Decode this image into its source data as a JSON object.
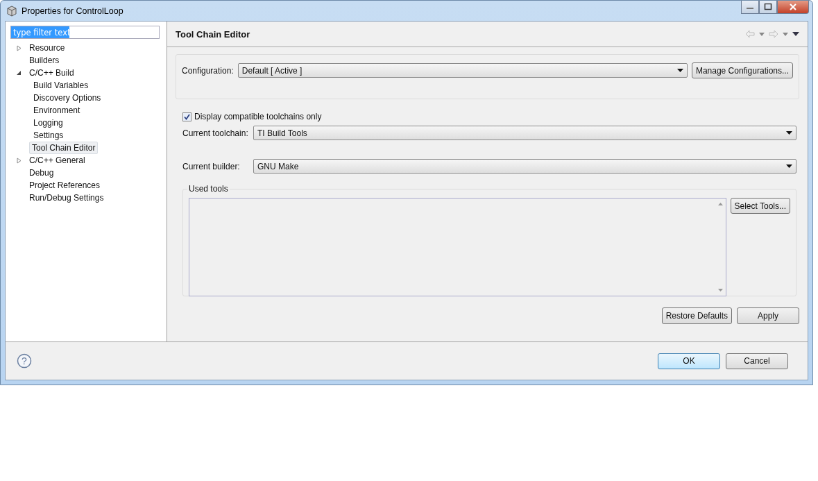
{
  "window": {
    "title": "Properties for ControlLoop"
  },
  "filter": {
    "value": "type filter text"
  },
  "tree": [
    {
      "label": "Resource",
      "kind": "group",
      "expanded": false,
      "selected": false
    },
    {
      "label": "Builders",
      "kind": "page",
      "selected": false
    },
    {
      "label": "C/C++ Build",
      "kind": "group",
      "expanded": true,
      "selected": false,
      "children": [
        {
          "label": "Build Variables",
          "selected": false
        },
        {
          "label": "Discovery Options",
          "selected": false
        },
        {
          "label": "Environment",
          "selected": false
        },
        {
          "label": "Logging",
          "selected": false
        },
        {
          "label": "Settings",
          "selected": false
        },
        {
          "label": "Tool Chain Editor",
          "selected": true
        }
      ]
    },
    {
      "label": "C/C++ General",
      "kind": "group",
      "expanded": false,
      "selected": false
    },
    {
      "label": "Debug",
      "kind": "page",
      "selected": false
    },
    {
      "label": "Project References",
      "kind": "page",
      "selected": false
    },
    {
      "label": "Run/Debug Settings",
      "kind": "page",
      "selected": false
    }
  ],
  "page": {
    "title": "Tool Chain Editor",
    "configuration": {
      "label": "Configuration:",
      "value": "Default  [ Active ]",
      "button": "Manage Configurations..."
    },
    "compatible_only": {
      "label": "Display compatible toolchains only",
      "checked": true
    },
    "toolchain": {
      "label": "Current toolchain:",
      "value": "TI Build Tools"
    },
    "builder": {
      "label": "Current builder:",
      "value": "GNU Make"
    },
    "used_tools": {
      "label": "Used tools",
      "button": "Select Tools..."
    },
    "buttons": [
      "Restore Defaults",
      "Apply"
    ]
  },
  "help": "?",
  "dialog_buttons": [
    "OK",
    "Cancel"
  ]
}
